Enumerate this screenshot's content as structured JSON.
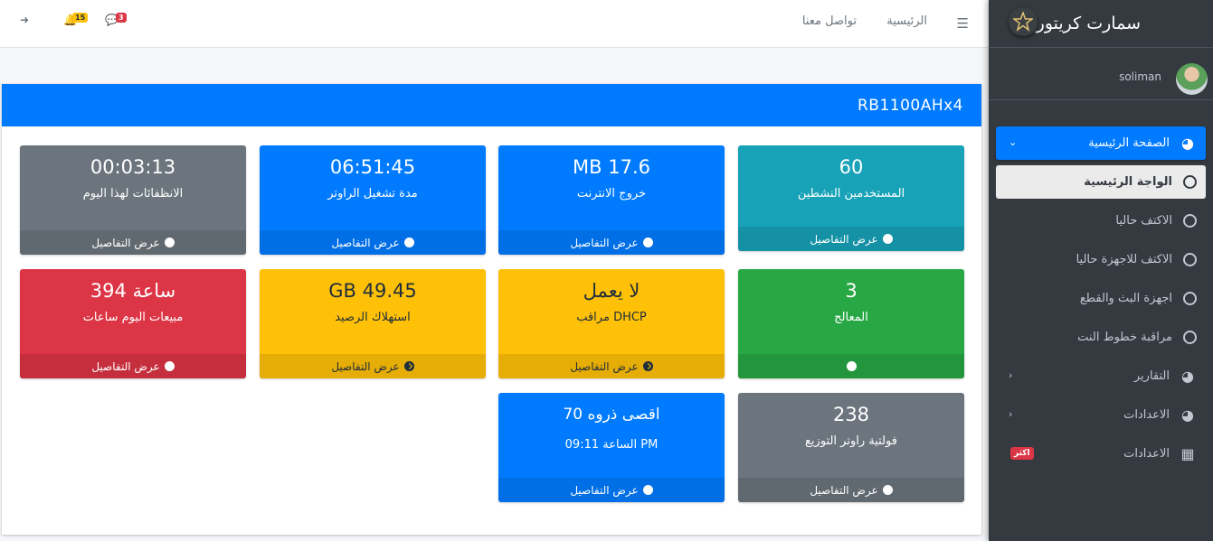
{
  "brand": {
    "title": "سمارت كريتور"
  },
  "user": {
    "name": "soliman"
  },
  "sidebar": {
    "items": [
      {
        "label": "الصفحة الرئيسية",
        "icon": "dashboard-icon",
        "active": true
      },
      {
        "label": "التقارير",
        "icon": "dashboard-icon"
      },
      {
        "label": "الاعدادات",
        "icon": "dashboard-icon"
      },
      {
        "label": "الاعدادات",
        "icon": "grid-icon",
        "badge": "اكثر"
      }
    ],
    "subitems": [
      {
        "label": "الواجة الرئيسية",
        "current": true
      },
      {
        "label": "الاكتف حاليا"
      },
      {
        "label": "الاكتف للاجهزة حاليا"
      },
      {
        "label": "اجهزة البث والقطع"
      },
      {
        "label": "مراقبة خطوط النت"
      }
    ]
  },
  "topbar": {
    "home": "الرئيسية",
    "contact": "تواصل معنا",
    "messages_count": "3",
    "notifications_count": "15"
  },
  "card": {
    "title": "RB1100AHx4"
  },
  "boxes": {
    "details": "عرض التفاصيل",
    "b1": {
      "value": "60",
      "label": "المستخدمين النشطين",
      "color": "#17a2b8"
    },
    "b2": {
      "value": "MB 17.6",
      "label": "خروج الانترنت",
      "color": "#007bff"
    },
    "b3": {
      "value": "06:51:45",
      "label": "مدة تشغيل الراوتر",
      "color": "#007bff"
    },
    "b4": {
      "value": "00:03:13",
      "label": "الانظفائات لهذا اليوم",
      "color": "#6c757d"
    },
    "b5": {
      "value": "3",
      "label": "المعالج",
      "color": "#28a745"
    },
    "b6": {
      "value": "لا يعمل",
      "label": "مراقب DHCP",
      "color": "#ffc107"
    },
    "b7": {
      "value": "GB 49.45",
      "label": "استهلاك الرصيد",
      "color": "#ffc107"
    },
    "b8": {
      "value": "394 ساعة",
      "label": "مبيعات اليوم ساعات",
      "color": "#dc3545"
    },
    "b9": {
      "value": "238",
      "label": "فولتية راوتر التوزيع",
      "color": "#6c757d"
    },
    "b10": {
      "value": "اقصى ذروه 70",
      "label": "الساعة 09:11 PM",
      "color": "#007bff"
    }
  }
}
